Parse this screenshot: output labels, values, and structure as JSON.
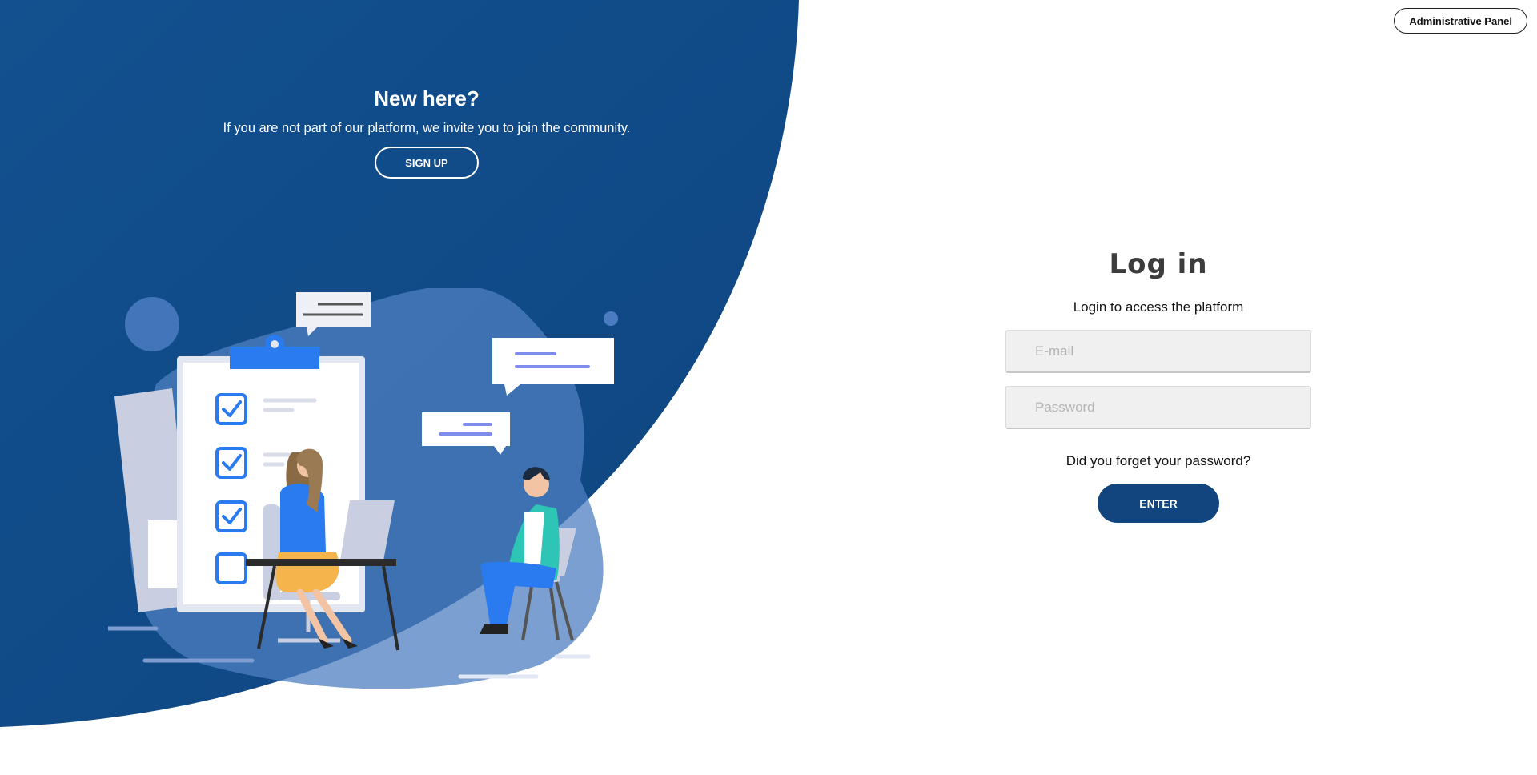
{
  "header": {
    "admin_label": "Administrative Panel"
  },
  "welcome": {
    "title": "New here?",
    "text": "If you are not part of our platform, we invite you to join the community.",
    "signup_label": "SIGN UP"
  },
  "login": {
    "title": "Log in",
    "subtitle": "Login to access the platform",
    "email_placeholder": "E-mail",
    "password_placeholder": "Password",
    "forgot_label": "Did you forget your password?",
    "enter_label": "ENTER"
  },
  "colors": {
    "brand_blue": "#12457e",
    "accent_blue": "#2a7bf0",
    "teal": "#2ec4b6",
    "skirt": "#f6b44c"
  },
  "illustration": {
    "icons": [
      "checklist-clipboard",
      "chat-bubble",
      "woman-at-desk",
      "man-on-chair",
      "laptop"
    ]
  }
}
